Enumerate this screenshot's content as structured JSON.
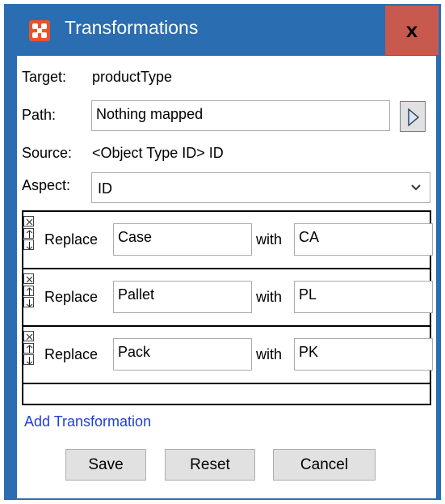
{
  "window": {
    "title": "Transformations",
    "close_label": "x",
    "accent": "#2a6db0",
    "close_color": "#c8594f",
    "icon_color": "#e8542c"
  },
  "target": {
    "label": "Target:",
    "value": "productType"
  },
  "path": {
    "label": "Path:",
    "value": "Nothing mapped",
    "icon": "play-arrow-icon"
  },
  "source": {
    "label": "Source:",
    "value": "<Object Type ID> ID"
  },
  "aspect": {
    "label": "Aspect:",
    "value": "ID",
    "icon": "chevron-down-icon"
  },
  "transformations": [
    {
      "action": "Replace",
      "find": "Case",
      "with_label": "with",
      "replace": "CA"
    },
    {
      "action": "Replace",
      "find": "Pallet",
      "with_label": "with",
      "replace": "PL"
    },
    {
      "action": "Replace",
      "find": "Pack",
      "with_label": "with",
      "replace": "PK"
    }
  ],
  "row_controls": [
    "remove-icon",
    "move-up-icon",
    "move-down-icon"
  ],
  "add_link": "Add Transformation",
  "link_color": "#1f3fd6",
  "buttons": {
    "save": "Save",
    "reset": "Reset",
    "cancel": "Cancel"
  }
}
